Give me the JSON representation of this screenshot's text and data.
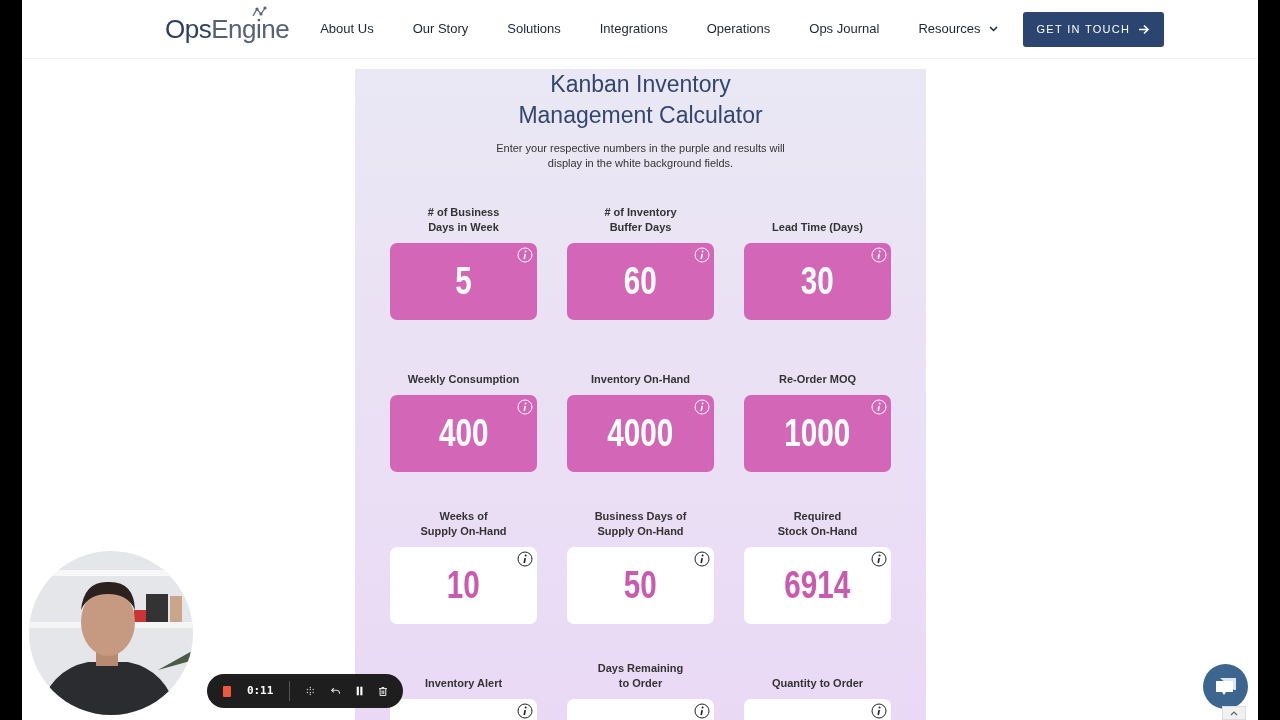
{
  "navbar": {
    "logo": {
      "first": "Ops",
      "second": "Engine"
    },
    "links": [
      {
        "label": "About Us",
        "dropdown": false
      },
      {
        "label": "Our Story",
        "dropdown": false
      },
      {
        "label": "Solutions",
        "dropdown": false
      },
      {
        "label": "Integrations",
        "dropdown": false
      },
      {
        "label": "Operations",
        "dropdown": false
      },
      {
        "label": "Ops Journal",
        "dropdown": false
      },
      {
        "label": "Resources",
        "dropdown": true
      }
    ],
    "cta": "GET IN TOUCH"
  },
  "calculator": {
    "title": "Kanban Inventory Management Calculator",
    "description": "Enter your respective numbers in the purple and results will display in the white background fields.",
    "fields": [
      {
        "label": "# of Business Days in Week",
        "value": "5",
        "kind": "input"
      },
      {
        "label": "# of Inventory Buffer Days",
        "value": "60",
        "kind": "input"
      },
      {
        "label": "Lead Time (Days)",
        "value": "30",
        "kind": "input"
      },
      {
        "label": "Weekly Consumption",
        "value": "400",
        "kind": "input"
      },
      {
        "label": "Inventory On-Hand",
        "value": "4000",
        "kind": "input"
      },
      {
        "label": "Re-Order MOQ",
        "value": "1000",
        "kind": "input"
      },
      {
        "label": "Weeks of Supply On-Hand",
        "value": "10",
        "kind": "output"
      },
      {
        "label": "Business Days of Supply On-Hand",
        "value": "50",
        "kind": "output"
      },
      {
        "label": "Required Stock On-Hand",
        "value": "6914",
        "kind": "output"
      },
      {
        "label": "Inventory Alert",
        "kind": "output"
      },
      {
        "label": "Days Remaining to Order",
        "kind": "output"
      },
      {
        "label": "Quantity to Order",
        "kind": "output"
      }
    ]
  },
  "recorder": {
    "time": "0:11"
  }
}
